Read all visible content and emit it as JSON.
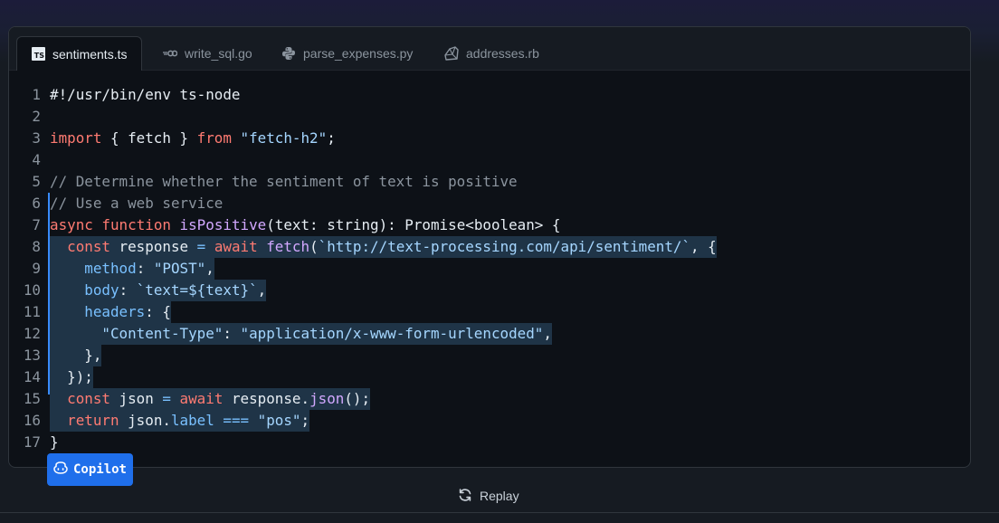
{
  "tabs": [
    {
      "label": "sentiments.ts",
      "icon": "typescript-icon",
      "active": true
    },
    {
      "label": "write_sql.go",
      "icon": "go-icon",
      "active": false
    },
    {
      "label": "parse_expenses.py",
      "icon": "python-icon",
      "active": false
    },
    {
      "label": "addresses.rb",
      "icon": "ruby-icon",
      "active": false
    }
  ],
  "typescript_badge": "TS",
  "code_lines": [
    {
      "n": "1",
      "tokens": [
        [
          "tx",
          "#!/usr/bin/env ts-node"
        ]
      ]
    },
    {
      "n": "2",
      "tokens": []
    },
    {
      "n": "3",
      "tokens": [
        [
          "kw",
          "import"
        ],
        [
          "tx",
          " { fetch } "
        ],
        [
          "kw",
          "from"
        ],
        [
          "tx",
          " "
        ],
        [
          "str",
          "\"fetch-h2\""
        ],
        [
          "tx",
          ";"
        ]
      ]
    },
    {
      "n": "4",
      "tokens": []
    },
    {
      "n": "5",
      "tokens": [
        [
          "cm",
          "// Determine whether the sentiment of text is positive"
        ]
      ]
    },
    {
      "n": "6",
      "tokens": [
        [
          "cm",
          "// Use a web service"
        ]
      ]
    },
    {
      "n": "7",
      "tokens": [
        [
          "kw",
          "async"
        ],
        [
          "tx",
          " "
        ],
        [
          "kw",
          "function"
        ],
        [
          "tx",
          " "
        ],
        [
          "fn",
          "isPositive"
        ],
        [
          "tx",
          "(text: string): Promise<boolean> {"
        ]
      ]
    },
    {
      "n": "8",
      "hl": true,
      "tokens": [
        [
          "tx",
          "  "
        ],
        [
          "kw",
          "const"
        ],
        [
          "tx",
          " response "
        ],
        [
          "op",
          "="
        ],
        [
          "tx",
          " "
        ],
        [
          "kw",
          "await"
        ],
        [
          "tx",
          " "
        ],
        [
          "fn",
          "fetch"
        ],
        [
          "tx",
          "("
        ],
        [
          "str",
          "`http://text-processing.com/api/sentiment/`"
        ],
        [
          "tx",
          ", {"
        ]
      ]
    },
    {
      "n": "9",
      "hl": true,
      "tokens": [
        [
          "tx",
          "    "
        ],
        [
          "prop",
          "method"
        ],
        [
          "tx",
          ": "
        ],
        [
          "str",
          "\"POST\""
        ],
        [
          "tx",
          ","
        ]
      ]
    },
    {
      "n": "10",
      "hl": true,
      "tokens": [
        [
          "tx",
          "    "
        ],
        [
          "prop",
          "body"
        ],
        [
          "tx",
          ": "
        ],
        [
          "str",
          "`text=${text}`"
        ],
        [
          "tx",
          ","
        ]
      ]
    },
    {
      "n": "11",
      "hl": true,
      "tokens": [
        [
          "tx",
          "    "
        ],
        [
          "prop",
          "headers"
        ],
        [
          "tx",
          ": {"
        ]
      ]
    },
    {
      "n": "12",
      "hl": true,
      "tokens": [
        [
          "tx",
          "      "
        ],
        [
          "str",
          "\"Content-Type\""
        ],
        [
          "tx",
          ": "
        ],
        [
          "str",
          "\"application/x-www-form-urlencoded\""
        ],
        [
          "tx",
          ","
        ]
      ]
    },
    {
      "n": "13",
      "hl": true,
      "tokens": [
        [
          "tx",
          "    },"
        ]
      ]
    },
    {
      "n": "14",
      "hl": true,
      "tokens": [
        [
          "tx",
          "  });"
        ]
      ]
    },
    {
      "n": "15",
      "hl": true,
      "tokens": [
        [
          "tx",
          "  "
        ],
        [
          "kw",
          "const"
        ],
        [
          "tx",
          " json "
        ],
        [
          "op",
          "="
        ],
        [
          "tx",
          " "
        ],
        [
          "kw",
          "await"
        ],
        [
          "tx",
          " response."
        ],
        [
          "fn",
          "json"
        ],
        [
          "tx",
          "();"
        ]
      ]
    },
    {
      "n": "16",
      "hl": true,
      "tokens": [
        [
          "tx",
          "  "
        ],
        [
          "kw",
          "return"
        ],
        [
          "tx",
          " json."
        ],
        [
          "prop",
          "label"
        ],
        [
          "tx",
          " "
        ],
        [
          "op",
          "==="
        ],
        [
          "tx",
          " "
        ],
        [
          "str",
          "\"pos\""
        ],
        [
          "tx",
          ";"
        ]
      ]
    },
    {
      "n": "17",
      "tokens": [
        [
          "tx",
          "}"
        ]
      ]
    }
  ],
  "copilot_label": "Copilot",
  "replay_label": "Replay",
  "colors": {
    "accent": "#1f6feb",
    "keyword": "#ff7b72",
    "string": "#a5d6ff",
    "comment": "#8b949e",
    "function": "#d2a8ff",
    "highlight": "#1f3447"
  }
}
